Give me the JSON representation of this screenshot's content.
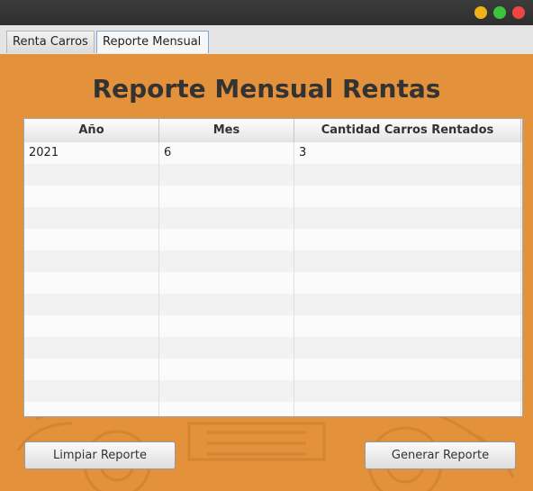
{
  "tabs": [
    {
      "label": "Renta Carros",
      "selected": false
    },
    {
      "label": "Reporte Mensual",
      "selected": true
    }
  ],
  "report": {
    "title": "Reporte Mensual Rentas",
    "columns": [
      "Año",
      "Mes",
      "Cantidad Carros Rentados"
    ],
    "rows": [
      [
        "2021",
        "6",
        "3"
      ]
    ],
    "visible_empty_rows": 12
  },
  "buttons": {
    "clear": "Limpiar Reporte",
    "generate": "Generar Reporte"
  },
  "colors": {
    "content_background": "#e3913a",
    "title_text": "#333333"
  }
}
